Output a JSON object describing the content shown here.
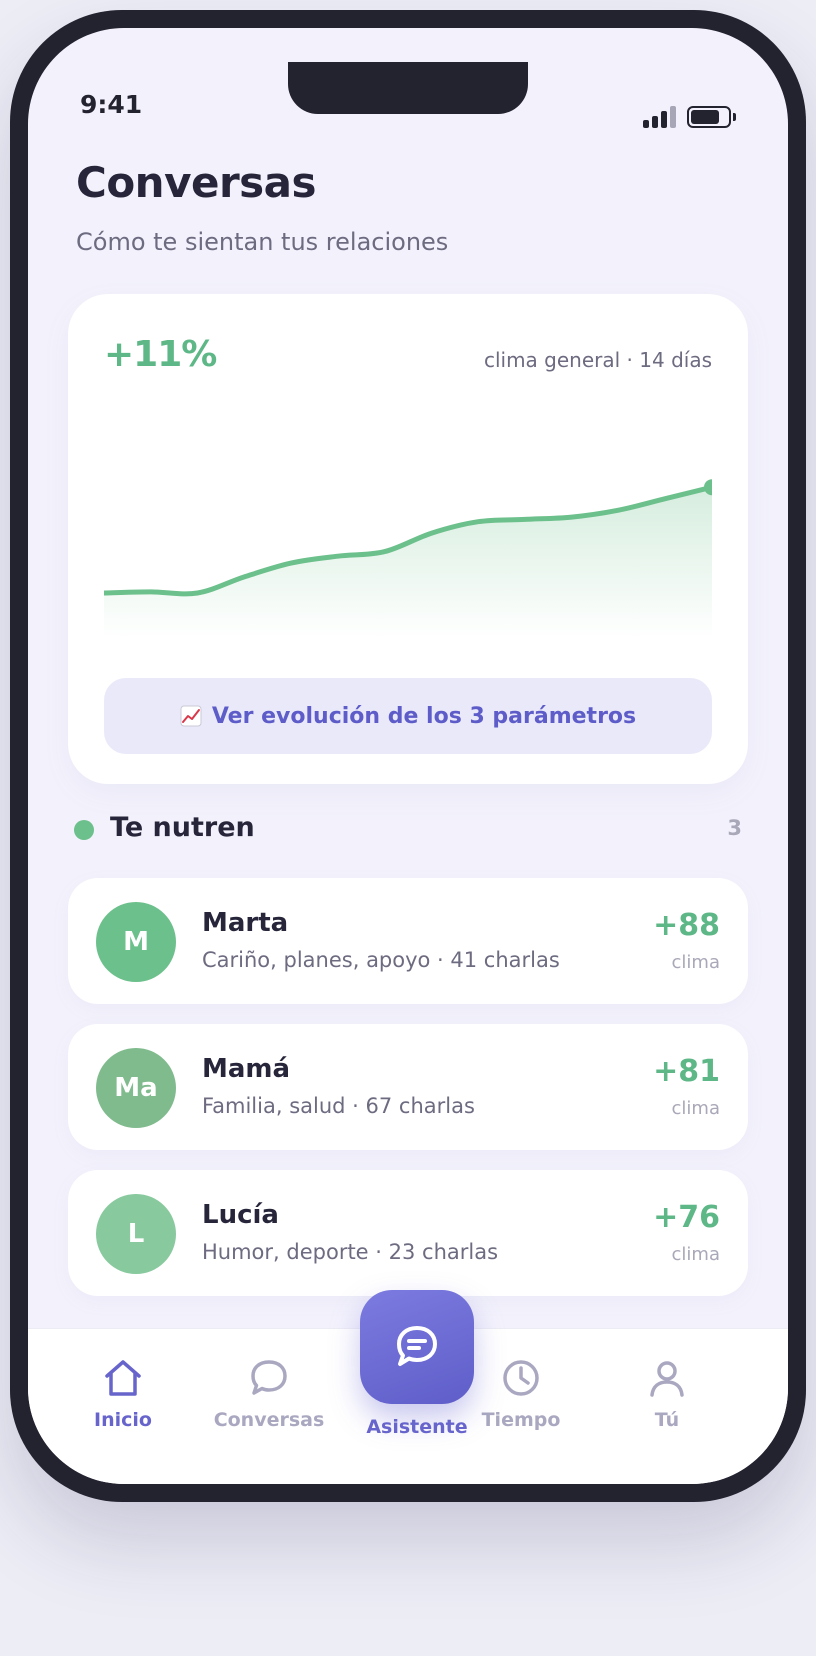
{
  "status_bar": {
    "time": "9:41"
  },
  "header": {
    "title": "Conversas",
    "subtitle": "Cómo te sientan tus relaciones"
  },
  "mood_card": {
    "change": "+11%",
    "caption": "clima general · 14 días",
    "button_label": "Ver evolución de los 3 parámetros",
    "button_icon": "chart-increasing-icon"
  },
  "chart_data": {
    "type": "area",
    "x": [
      1,
      2,
      3,
      4,
      5,
      6,
      7,
      8,
      9,
      10,
      11,
      12,
      13,
      14
    ],
    "values": [
      20,
      20.5,
      20,
      27,
      33,
      36,
      38,
      46,
      51,
      52,
      53,
      56,
      61,
      66
    ],
    "ylim": [
      0,
      100
    ],
    "grid": false,
    "colors": {
      "line": "#6cc08b",
      "fill": "#d6efe0"
    }
  },
  "section": {
    "title": "Te nutren",
    "count": "3",
    "dot_color": "#6cc08b"
  },
  "contacts": [
    {
      "initials": "M",
      "name": "Marta",
      "description": "Cariño, planes, apoyo · 41 charlas",
      "score": "+88",
      "score_label": "clima",
      "avatar_color": "#6cc08b"
    },
    {
      "initials": "Ma",
      "name": "Mamá",
      "description": "Familia, salud · 67 charlas",
      "score": "+81",
      "score_label": "clima",
      "avatar_color": "#80bb8e"
    },
    {
      "initials": "L",
      "name": "Lucía",
      "description": "Humor, deporte · 23 charlas",
      "score": "+76",
      "score_label": "clima",
      "avatar_color": "#88c99e"
    }
  ],
  "tabbar": {
    "tabs": [
      {
        "label": "Inicio",
        "icon": "home-icon",
        "active": true
      },
      {
        "label": "Conversas",
        "icon": "chat-bubble-icon",
        "active": false
      },
      {
        "label": "Tiempo",
        "icon": "clock-icon",
        "active": false
      },
      {
        "label": "Tú",
        "icon": "user-icon",
        "active": false
      }
    ],
    "center": {
      "label": "Asistente",
      "icon": "assistant-chat-icon"
    }
  },
  "colors": {
    "accent": "#6765cc",
    "positive": "#5db786",
    "background": "#f3f2fc"
  }
}
